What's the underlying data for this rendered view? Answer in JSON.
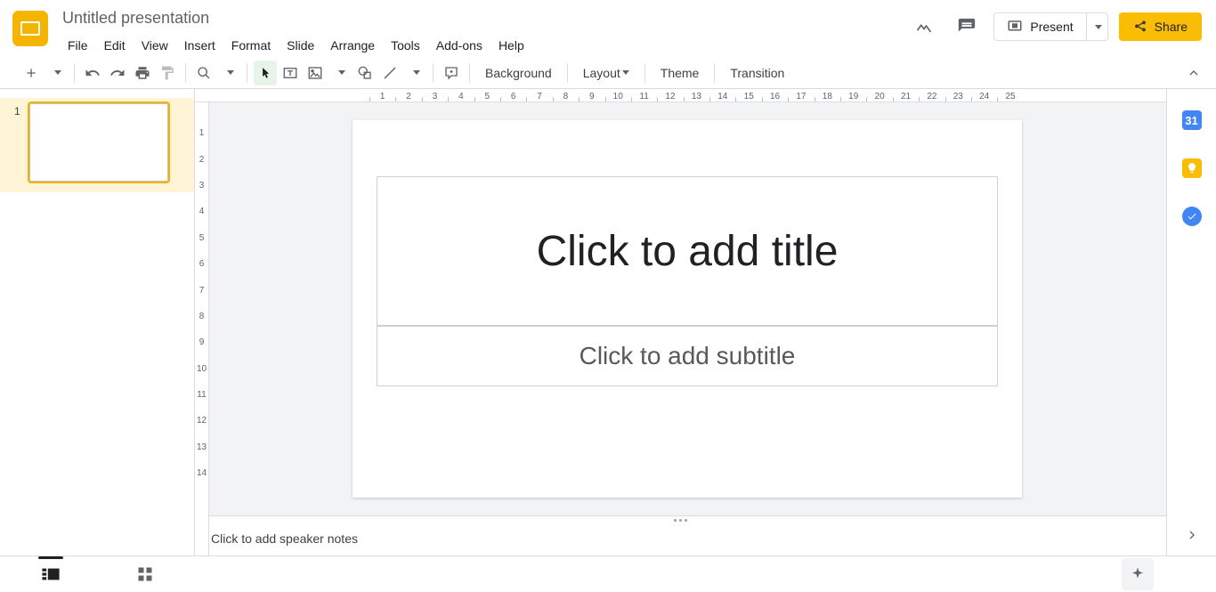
{
  "doc": {
    "title": "Untitled presentation"
  },
  "menu": {
    "items": [
      "File",
      "Edit",
      "View",
      "Insert",
      "Format",
      "Slide",
      "Arrange",
      "Tools",
      "Add-ons",
      "Help"
    ]
  },
  "header": {
    "present": "Present",
    "share": "Share"
  },
  "toolbar": {
    "background": "Background",
    "layout": "Layout",
    "theme": "Theme",
    "transition": "Transition"
  },
  "ruler_h": [
    "1",
    "2",
    "3",
    "4",
    "5",
    "6",
    "7",
    "8",
    "9",
    "10",
    "11",
    "12",
    "13",
    "14",
    "15",
    "16",
    "17",
    "18",
    "19",
    "20",
    "21",
    "22",
    "23",
    "24",
    "25"
  ],
  "ruler_v": [
    "1",
    "2",
    "3",
    "4",
    "5",
    "6",
    "7",
    "8",
    "9",
    "10",
    "11",
    "12",
    "13",
    "14"
  ],
  "filmstrip": {
    "slides": [
      {
        "num": "1"
      }
    ]
  },
  "slide": {
    "title_placeholder": "Click to add title",
    "subtitle_placeholder": "Click to add subtitle"
  },
  "notes": {
    "placeholder": "Click to add speaker notes"
  }
}
